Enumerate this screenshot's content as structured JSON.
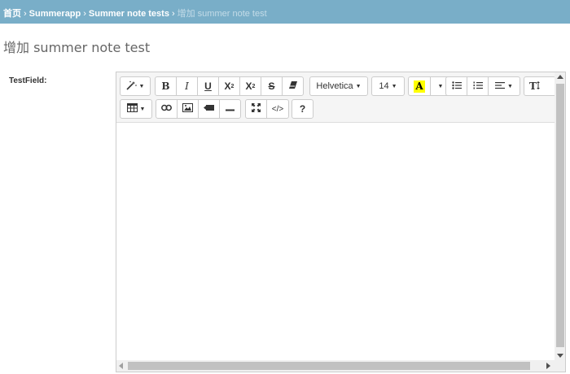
{
  "breadcrumbs": {
    "items": [
      "首页",
      "Summerapp",
      "Summer note tests"
    ],
    "separator": "›",
    "current": "增加 summer note test"
  },
  "page": {
    "title": "增加 summer note test"
  },
  "form": {
    "field_label": "TestField:"
  },
  "toolbar": {
    "font_name": "Helvetica",
    "font_size": "14",
    "highlight_letter": "A",
    "bold": "B",
    "italic": "I",
    "underline": "U",
    "strike": "S",
    "superscript_base": "X",
    "superscript_mark": "2",
    "subscript_base": "X",
    "subscript_mark": "2",
    "help": "?",
    "code": "</>",
    "hr": "—"
  },
  "colors": {
    "breadcrumb_bg": "#79aec8",
    "highlight": "#ffff00"
  }
}
